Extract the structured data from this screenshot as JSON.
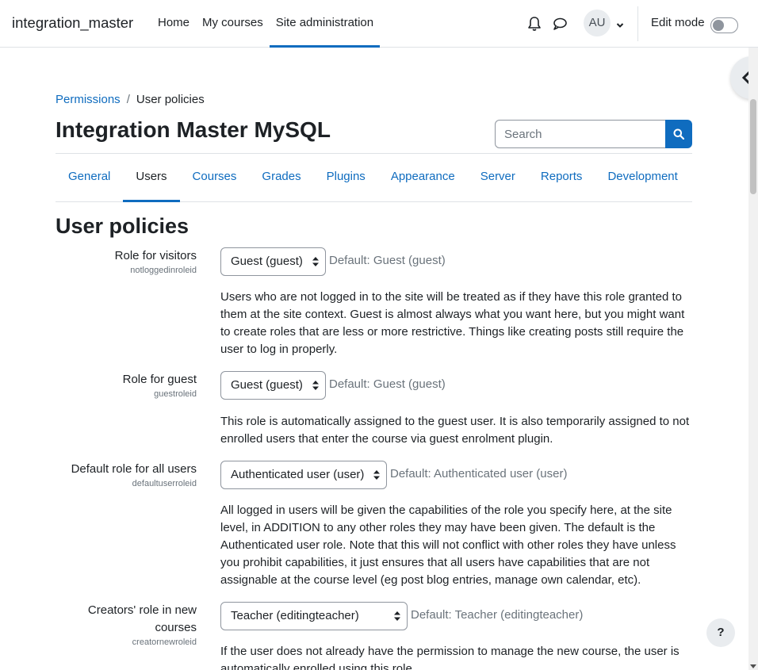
{
  "navbar": {
    "brand": "integration_master",
    "links": [
      {
        "label": "Home"
      },
      {
        "label": "My courses"
      },
      {
        "label": "Site administration"
      }
    ],
    "user_initials": "AU",
    "edit_mode_label": "Edit mode",
    "edit_mode_on": false
  },
  "breadcrumb": {
    "items": [
      "Permissions",
      "User policies"
    ],
    "separator": "/"
  },
  "header": {
    "title": "Integration Master MySQL",
    "search_placeholder": "Search"
  },
  "tabs": [
    {
      "label": "General"
    },
    {
      "label": "Users"
    },
    {
      "label": "Courses"
    },
    {
      "label": "Grades"
    },
    {
      "label": "Plugins"
    },
    {
      "label": "Appearance"
    },
    {
      "label": "Server"
    },
    {
      "label": "Reports"
    },
    {
      "label": "Development"
    }
  ],
  "active_tab": "Users",
  "section_title": "User policies",
  "settings": [
    {
      "label": "Role for visitors",
      "key": "notloggedinroleid",
      "value": "Guest (guest)",
      "default": "Default: Guest (guest)",
      "description": "Users who are not logged in to the site will be treated as if they have this role granted to them at the site context. Guest is almost always what you want here, but you might want to create roles that are less or more restrictive. Things like creating posts still require the user to log in properly."
    },
    {
      "label": "Role for guest",
      "key": "guestroleid",
      "value": "Guest (guest)",
      "default": "Default: Guest (guest)",
      "description": "This role is automatically assigned to the guest user. It is also temporarily assigned to not enrolled users that enter the course via guest enrolment plugin."
    },
    {
      "label": "Default role for all users",
      "key": "defaultuserroleid",
      "value": "Authenticated user (user)",
      "default": "Default: Authenticated user (user)",
      "description": "All logged in users will be given the capabilities of the role you specify here, at the site level, in ADDITION to any other roles they may have been given. The default is the Authenticated user role. Note that this will not conflict with other roles they have unless you prohibit capabilities, it just ensures that all users have capabilities that are not assignable at the course level (eg post blog entries, manage own calendar, etc)."
    },
    {
      "label": "Creators' role in new courses",
      "key": "creatornewroleid",
      "value": "Teacher (editingteacher)",
      "default": "Default: Teacher (editingteacher)",
      "description": "If the user does not already have the permission to manage the new course, the user is automatically enrolled using this role."
    }
  ],
  "help_button": "?"
}
